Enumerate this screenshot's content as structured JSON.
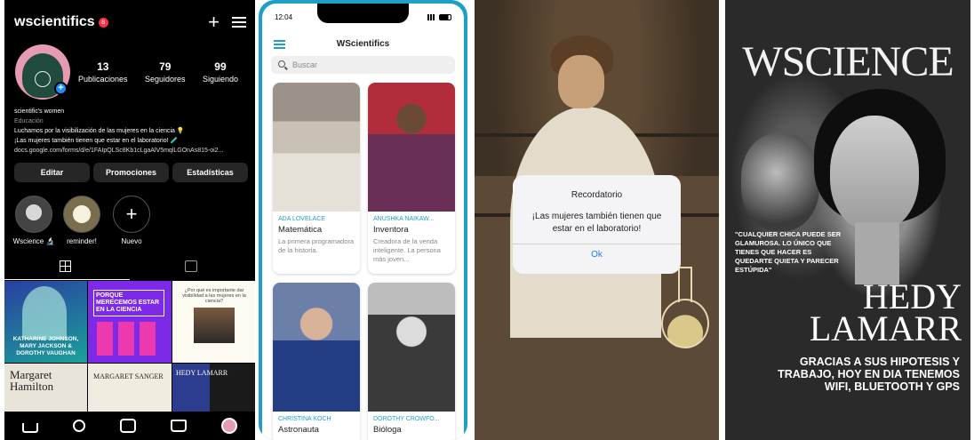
{
  "instagram": {
    "username": "wscientifics",
    "notif_count": "8",
    "stats": [
      {
        "value": "13",
        "label": "Publicaciones"
      },
      {
        "value": "79",
        "label": "Seguidores"
      },
      {
        "value": "99",
        "label": "Siguiendo"
      }
    ],
    "display_name": "scientific's women",
    "category": "Educación",
    "bio_line1": "Luchamos por la visibilización de las mujeres en la ciencia 💡",
    "bio_line2": "¡Las mujeres también tienen que estar en el laboratorio! 🧪",
    "bio_link": "docs.google.com/forms/d/e/1FAIpQLSc8Kb1cLgaAlV5mqlLGOnAs815-oi2...",
    "buttons": [
      "Editar",
      "Promociones",
      "Estadísticas"
    ],
    "highlights": [
      "Wscience 🔬",
      "reminder!",
      "Nuevo"
    ],
    "new_highlight_symbol": "+",
    "grid_posts": [
      "KATHARINE JOHNSON, MARY JACKSON & DOROTHY VAUGHAN",
      "PORQUE MERECEMOS ESTAR EN LA CIENCIA",
      "¿Por qué es importante dar visibilidad a las mujeres en la ciencia?",
      "Margaret Hamilton",
      "MARGARET SANGER",
      "HEDY LAMARR"
    ],
    "nav_icons": [
      "home-icon",
      "search-icon",
      "reels-icon",
      "shop-icon",
      "profile-icon"
    ]
  },
  "app": {
    "time": "12:04",
    "title": "WScientifics",
    "search_placeholder": "Buscar",
    "cards": [
      {
        "name": "ADA LOVELACE",
        "role": "Matemática",
        "desc": "La primera programadora de la historia."
      },
      {
        "name": "ANUSHKA NAIKAW...",
        "role": "Inventora",
        "desc": "Creadora de la venda inteligente. La persona más joven..."
      },
      {
        "name": "CHRISTINA KOCH",
        "role": "Astronauta",
        "desc": ""
      },
      {
        "name": "DOROTHY CROWFO...",
        "role": "Bióloga",
        "desc": ""
      }
    ],
    "accent": "#1ea0c5"
  },
  "reminder": {
    "title": "Recordatorio",
    "message": "¡Las mujeres también tienen que estar en el laboratorio!",
    "ok": "Ok",
    "ok_color": "#1f7ff0"
  },
  "poster": {
    "brand": "WSCIENCE",
    "quote": "\"Cualquier chica puede ser glamurosa. Lo único que tienes que hacer es quedarte quieta y parecer estúpida\"",
    "name_line1": "HEDY",
    "name_line2": "LAMARR",
    "fact": "GRACIAS A SUS HIPOTESIS Y TRABAJO, HOY EN DIA TENEMOS WIFI, BLUETOOTH Y GPS"
  }
}
